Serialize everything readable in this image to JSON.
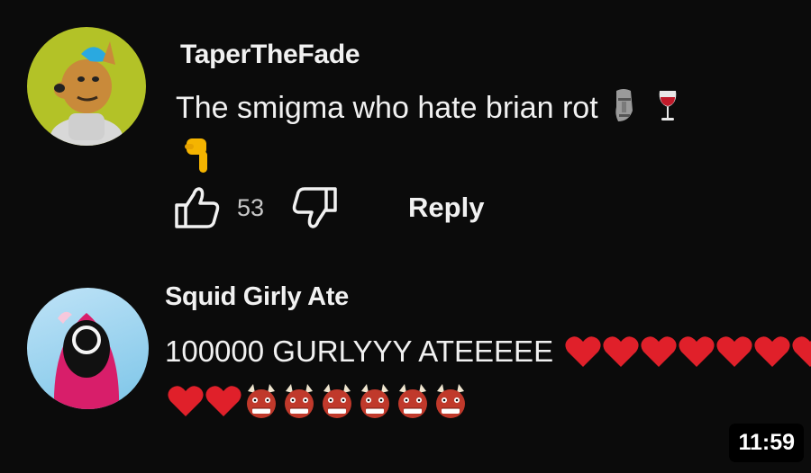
{
  "comments": [
    {
      "username": "TaperTheFade",
      "text": "The smigma who hate brian rot",
      "emoji_line1": [
        "moai-emoji",
        "wine-glass-emoji"
      ],
      "emoji_line2": [
        "point-down-emoji"
      ],
      "likes": "53",
      "reply_label": "Reply"
    },
    {
      "username": "Squid Girly Ate",
      "text": "100000 GURLYYY ATEEEEE",
      "line1_hearts": 7,
      "line2_hearts": 2,
      "line2_ogres": 6
    }
  ],
  "video": {
    "timestamp": "11:59"
  },
  "colors": {
    "background": "#0b0b0b",
    "text": "#f1f1f1",
    "heart": "#e0202a"
  }
}
